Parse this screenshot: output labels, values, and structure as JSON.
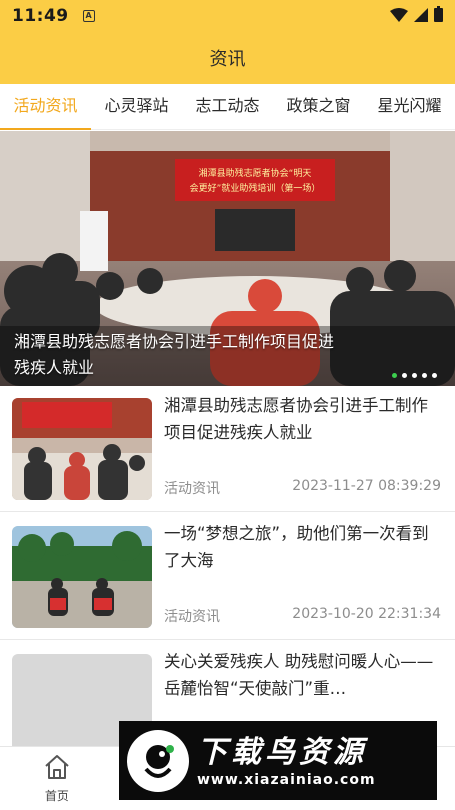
{
  "status": {
    "time": "11:49",
    "indicator": "A"
  },
  "header": {
    "title": "资讯"
  },
  "tabs": [
    {
      "label": "活动资讯",
      "active": true
    },
    {
      "label": "心灵驿站",
      "active": false
    },
    {
      "label": "志工动态",
      "active": false
    },
    {
      "label": "政策之窗",
      "active": false
    },
    {
      "label": "星光闪耀",
      "active": false
    }
  ],
  "banner": {
    "photo_sign_lines": [
      "湘潭县助残志愿者协会“明天",
      "会更好”就业助残培训（第一场）"
    ],
    "caption": "湘潭县助残志愿者协会引进手工制作项目促进残疾人就业",
    "slide_count": 5,
    "active_slide": 1
  },
  "news": [
    {
      "title": "湘潭县助残志愿者协会引进手工制作项目促进残疾人就业",
      "category": "活动资讯",
      "date": "2023-11-27 08:39:29"
    },
    {
      "title": "一场“梦想之旅”，助他们第一次看到了大海",
      "category": "活动资讯",
      "date": "2023-10-20 22:31:34"
    },
    {
      "title": "关心关爱残疾人 助残慰问暖人心——岳麓怡智“天使敲门”重…",
      "category": "",
      "date": ""
    }
  ],
  "bottom_nav": {
    "home_label": "首页"
  },
  "watermark": {
    "text": "下载鸟资源",
    "url": "www.xiazainiao.com"
  },
  "icons": {
    "wifi": "wifi-icon",
    "signal": "signal-icon",
    "battery": "battery-icon",
    "home": "home-icon"
  }
}
